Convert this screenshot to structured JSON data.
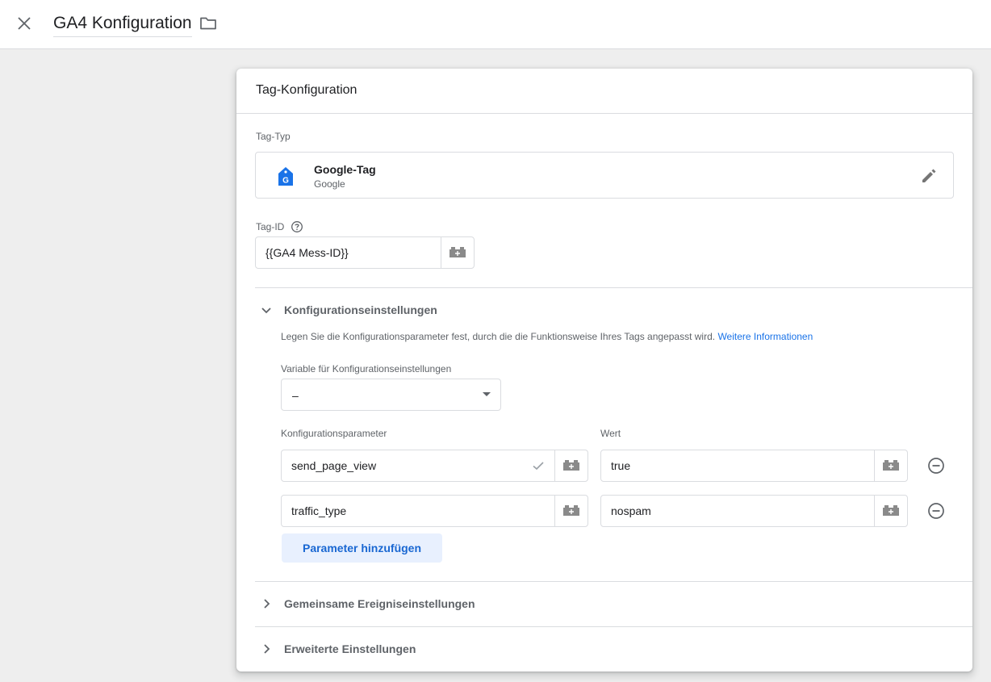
{
  "header": {
    "title": "GA4 Konfiguration"
  },
  "card": {
    "title": "Tag-Konfiguration",
    "tag_type_label": "Tag-Typ",
    "tag_type": {
      "name": "Google-Tag",
      "vendor": "Google",
      "icon_letter": "G"
    },
    "tag_id_label": "Tag-ID",
    "tag_id_value": "{{GA4 Mess-ID}}",
    "config_section": {
      "title": "Konfigurationseinstellungen",
      "expanded": true,
      "description": "Legen Sie die Konfigurationsparameter fest, durch die die Funktionsweise Ihres Tags angepasst wird.",
      "link": "Weitere Informationen",
      "variable_label": "Variable für Konfigurationseinstellungen",
      "variable_value": "–",
      "param_header": "Konfigurationsparameter",
      "value_header": "Wert",
      "rows": [
        {
          "param": "send_page_view",
          "value": "true",
          "validated": true
        },
        {
          "param": "traffic_type",
          "value": "nospam",
          "validated": false
        }
      ],
      "add_button": "Parameter hinzufügen"
    },
    "event_section": {
      "title": "Gemeinsame Ereigniseinstellungen",
      "expanded": false
    },
    "advanced_section": {
      "title": "Erweiterte Einstellungen",
      "expanded": false
    }
  },
  "colors": {
    "accent": "#1a73e8",
    "icon_gray": "#5f6368",
    "border": "#dadce0",
    "background": "#eeeeee"
  },
  "icons": [
    "close-icon",
    "folder-icon",
    "google-tag-icon",
    "pencil-icon",
    "help-icon",
    "chevron-down-icon",
    "chevron-right-icon",
    "variable-brick-icon",
    "check-icon",
    "remove-circle-icon",
    "dropdown-caret-icon"
  ]
}
